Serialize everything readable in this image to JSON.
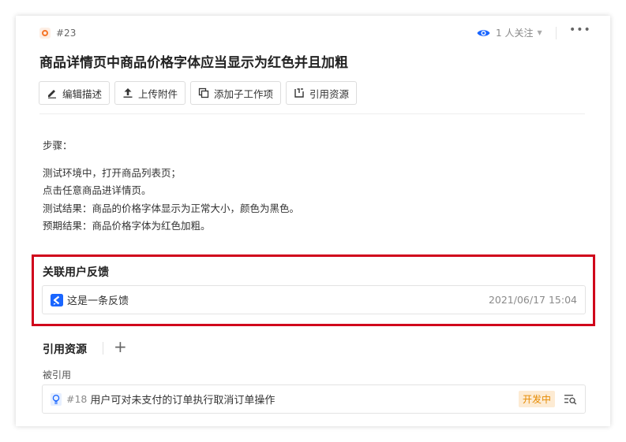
{
  "header": {
    "issue_id": "#23",
    "watchers": "1 人关注",
    "more": "•••"
  },
  "title": "商品详情页中商品价格字体应当显示为红色并且加粗",
  "toolbar": {
    "edit": "编辑描述",
    "upload": "上传附件",
    "add_child": "添加子工作项",
    "cite": "引用资源"
  },
  "description": {
    "heading": "步骤：",
    "lines": [
      "测试环境中，打开商品列表页；",
      "点击任意商品进详情页。",
      "测试结果：商品的价格字体显示为正常大小，颜色为黑色。",
      "预期结果：商品价格字体为红色加粗。"
    ]
  },
  "feedback": {
    "section_title": "关联用户反馈",
    "item": {
      "title": "这是一条反馈",
      "time": "2021/06/17 15:04"
    }
  },
  "references": {
    "section_title": "引用资源",
    "add": "+",
    "sub_label": "被引用",
    "item": {
      "id": "#18",
      "title": "用户可对未支付的订单执行取消订单操作",
      "status": "开发中"
    }
  },
  "colors": {
    "accent": "#1a66ff",
    "status_orange": "#f5762a",
    "highlight_red": "#d0021b",
    "badge_bg": "#fdebd3",
    "badge_text": "#e58a00"
  },
  "icons": [
    "status-circle-icon",
    "eye-icon",
    "caret-down-icon",
    "more-icon",
    "edit-icon",
    "upload-icon",
    "subtask-icon",
    "cite-icon",
    "feedback-icon",
    "plus-icon",
    "bulb-icon",
    "search-list-icon"
  ]
}
